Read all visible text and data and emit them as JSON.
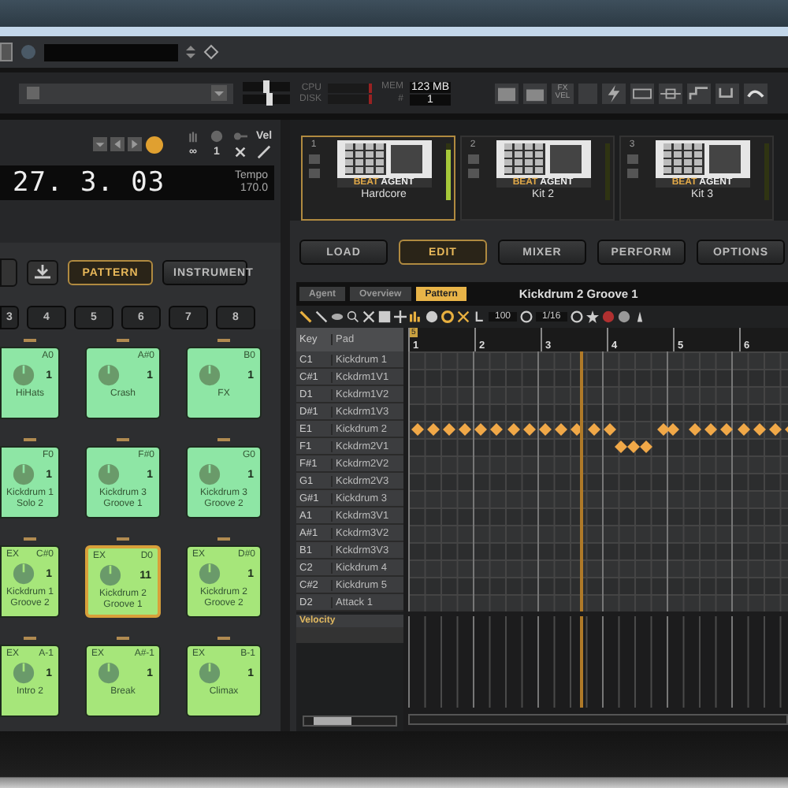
{
  "meters": {
    "cpu_label": "CPU",
    "disk_label": "DISK",
    "mem_label": "MEM",
    "mem_value": "123 MB",
    "count_label": "#",
    "count_value": "1",
    "fx_label": "FX VEL"
  },
  "sliders": [
    {
      "level": 0.5
    },
    {
      "level": 0.58
    }
  ],
  "transport": {
    "vel_label": "Vel",
    "loop": "∞",
    "count": "1",
    "position": "27. 3. 03",
    "tempo_label": "Tempo",
    "tempo": "170.0"
  },
  "kits": [
    {
      "number": "1",
      "name": "Hardcore",
      "brand_a": "BEAT",
      "brand_b": "AGENT",
      "selected": true,
      "level": 0.9
    },
    {
      "number": "2",
      "name": "Kit 2",
      "brand_a": "BEAT",
      "brand_b": "AGENT",
      "selected": false,
      "level": 0
    },
    {
      "number": "3",
      "name": "Kit 3",
      "brand_a": "BEAT",
      "brand_b": "AGENT",
      "selected": false,
      "level": 0
    }
  ],
  "left_buttons": [
    {
      "label": "PATTERN",
      "selected": true
    },
    {
      "label": "INSTRUMENT",
      "selected": false
    }
  ],
  "right_buttons": [
    {
      "label": "LOAD",
      "selected": false
    },
    {
      "label": "EDIT",
      "selected": true
    },
    {
      "label": "MIXER",
      "selected": false
    },
    {
      "label": "PERFORM",
      "selected": false
    },
    {
      "label": "OPTIONS",
      "selected": false
    }
  ],
  "banks": [
    "3",
    "4",
    "5",
    "6",
    "7",
    "8"
  ],
  "pads": [
    {
      "note": "A0",
      "name": "HiHats",
      "value": "1",
      "selected": false,
      "color": "#8ee6a5"
    },
    {
      "note": "A#0",
      "name": "Crash",
      "value": "1",
      "selected": false,
      "color": "#8ee6a5"
    },
    {
      "note": "B0",
      "name": "FX",
      "value": "1",
      "selected": false,
      "color": "#8ee6a5"
    },
    {
      "note": "F0",
      "name": "Kickdrum 1 Solo 2",
      "value": "1",
      "selected": false,
      "color": "#8ee6a5"
    },
    {
      "note": "F#0",
      "name": "Kickdrum 3 Groove 1",
      "value": "1",
      "selected": false,
      "color": "#8ee6a5"
    },
    {
      "note": "G0",
      "name": "Kickdrum 3 Groove 2",
      "value": "1",
      "selected": false,
      "color": "#8ee6a5"
    },
    {
      "tag": "EX",
      "note": "C#0",
      "name": "Kickdrum 1 Groove 2",
      "value": "1",
      "selected": false,
      "color": "#a6e67a"
    },
    {
      "tag": "EX",
      "note": "D0",
      "name": "Kickdrum 2 Groove 1",
      "value": "11",
      "selected": true,
      "color": "#a6e67a"
    },
    {
      "tag": "EX",
      "note": "D#0",
      "name": "Kickdrum 2 Groove 2",
      "value": "1",
      "selected": false,
      "color": "#a6e67a"
    },
    {
      "tag": "EX",
      "note": "A-1",
      "name": "Intro 2",
      "value": "1",
      "selected": false,
      "color": "#a6e67a"
    },
    {
      "tag": "EX",
      "note": "A#-1",
      "name": "Break",
      "value": "1",
      "selected": false,
      "color": "#a6e67a"
    },
    {
      "tag": "EX",
      "note": "B-1",
      "name": "Climax",
      "value": "1",
      "selected": false,
      "color": "#a6e67a"
    }
  ],
  "editor": {
    "tabs": [
      {
        "label": "Agent",
        "selected": false
      },
      {
        "label": "Overview",
        "selected": false
      },
      {
        "label": "Pattern",
        "selected": true
      }
    ],
    "title": "Kickdrum 2 Groove 1",
    "velocity_value": "100",
    "quantize": "1/16",
    "loop_marker": "5",
    "bars": [
      "1",
      "2",
      "3",
      "4",
      "5",
      "6"
    ],
    "columns": [
      "Key",
      "Pad"
    ],
    "rows": [
      {
        "key": "C1",
        "pad": "Kickdrum 1"
      },
      {
        "key": "C#1",
        "pad": "Kckdrm1V1"
      },
      {
        "key": "D1",
        "pad": "Kckdrm1V2"
      },
      {
        "key": "D#1",
        "pad": "Kckdrm1V3"
      },
      {
        "key": "E1",
        "pad": "Kickdrum 2"
      },
      {
        "key": "F1",
        "pad": "Kckdrm2V1"
      },
      {
        "key": "F#1",
        "pad": "Kckdrm2V2"
      },
      {
        "key": "G1",
        "pad": "Kckdrm2V3"
      },
      {
        "key": "G#1",
        "pad": "Kickdrum 3"
      },
      {
        "key": "A1",
        "pad": "Kckdrm3V1"
      },
      {
        "key": "A#1",
        "pad": "Kckdrm3V2"
      },
      {
        "key": "B1",
        "pad": "Kckdrm3V3"
      },
      {
        "key": "C2",
        "pad": "Kickdrum 4"
      },
      {
        "key": "C#2",
        "pad": "Kickdrum 5"
      },
      {
        "key": "D2",
        "pad": "Attack 1"
      }
    ],
    "velocity_label": "Velocity"
  }
}
